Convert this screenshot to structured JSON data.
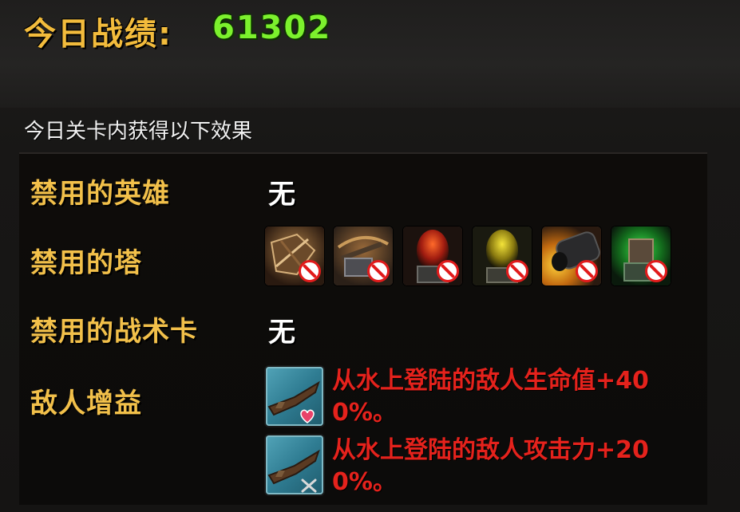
{
  "header": {
    "score_label": "今日战绩:",
    "score_value": "61302"
  },
  "effects": {
    "title": "今日关卡内获得以下效果",
    "banned_heroes": {
      "label": "禁用的英雄",
      "value": "无"
    },
    "banned_towers": {
      "label": "禁用的塔",
      "icons": [
        "crossbow-tower-icon",
        "ballista-tower-icon",
        "fire-tower-icon",
        "poison-tower-icon",
        "cannon-tower-icon",
        "green-mech-tower-icon"
      ],
      "ban_icon": "ban-icon"
    },
    "banned_cards": {
      "label": "禁用的战术卡",
      "value": "无"
    },
    "enemy_buffs": {
      "label": "敌人增益",
      "items": [
        {
          "text": "从水上登陆的敌人生命值+400%。",
          "icon": "boat-heart-icon"
        },
        {
          "text": "从水上登陆的敌人攻击力+200%。",
          "icon": "boat-swords-icon"
        }
      ]
    }
  },
  "colors": {
    "label_gold": "#f2c04a",
    "score_green": "#7cf12d",
    "buff_red": "#e5221c",
    "ban_red": "#e11b1b"
  }
}
